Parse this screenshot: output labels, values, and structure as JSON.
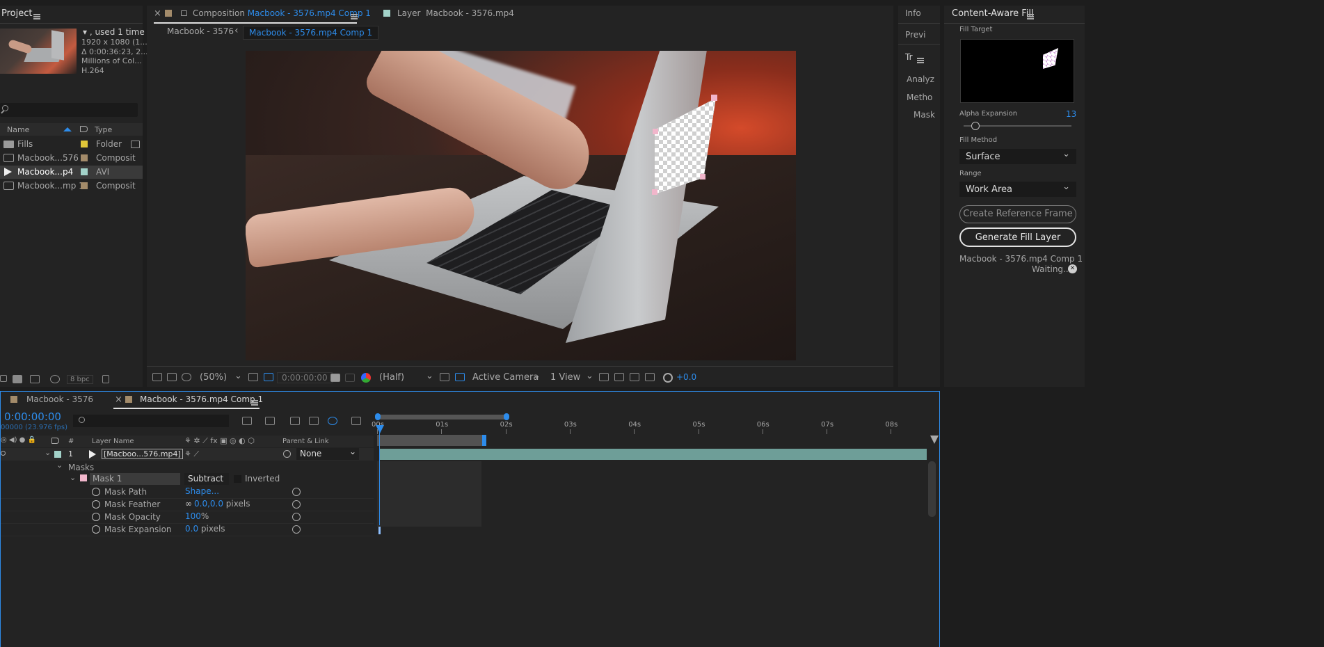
{
  "colors": {
    "accent": "#2d8ceb",
    "folder": "#e0c639",
    "comp": "#a38b6a",
    "avi": "#a3d2c9",
    "mask": "#f1b6cb",
    "bg": "#232323"
  },
  "project": {
    "title": "Project",
    "info": {
      "used": "▾ , used 1 time",
      "res": "1920 x 1080 (1...",
      "duration": "Δ 0:00:36:23, 2...",
      "colors": "Millions of Col...",
      "codec": "H.264"
    },
    "search_placeholder": "",
    "columns": {
      "name": "Name",
      "type": "Type"
    },
    "items": [
      {
        "name": "Fills",
        "type": "Folder",
        "icon": "folder-icon"
      },
      {
        "name": "Macbook...576",
        "type": "Composit",
        "icon": "composition-icon"
      },
      {
        "name": "Macbook...p4",
        "type": "AVI",
        "icon": "footage-icon"
      },
      {
        "name": "Macbook...mp 1",
        "type": "Composit",
        "icon": "composition-icon"
      }
    ],
    "bpc": "8 bpc"
  },
  "comp_viewer": {
    "tab_close": "×",
    "tab_prefix": "Composition",
    "tab_name": "Macbook - 3576.mp4 Comp 1",
    "layer_tab_prefix": "Layer",
    "layer_tab_name": "Macbook - 3576.mp4",
    "breadcrumb_1": "Macbook - 3576",
    "breadcrumb_arrow": "‹",
    "breadcrumb_2": "Macbook - 3576.mp4 Comp 1",
    "toolbar": {
      "zoom": "(50%)",
      "timecode": "0:00:00:00",
      "resolution": "(Half)",
      "camera": "Active Camera",
      "view": "1 View",
      "exposure": "+0.0"
    }
  },
  "side_tabs": {
    "info": "Info",
    "preview": "Previ",
    "tracker": "Tr",
    "analyze": "Analyz",
    "method": "Metho",
    "mask": "Mask"
  },
  "caf": {
    "title": "Content-Aware Fill",
    "fill_target_label": "Fill Target",
    "alpha_expansion_label": "Alpha Expansion",
    "alpha_expansion_value": "13",
    "alpha_expansion_level": 0.11,
    "fill_method_label": "Fill Method",
    "fill_method_value": "Surface",
    "range_label": "Range",
    "range_value": "Work Area",
    "create_ref_btn": "Create Reference Frame",
    "generate_btn": "Generate Fill Layer",
    "status_title": "Macbook - 3576.mp4 Comp 1",
    "status_text": "Waiting...",
    "cancel_glyph": "✕"
  },
  "timeline": {
    "tab1": "Macbook - 3576",
    "tab2_close": "×",
    "tab2": "Macbook - 3576.mp4 Comp 1",
    "timecode": "0:00:00:00",
    "frames": "00000 (23.976 fps)",
    "search_placeholder": "",
    "col_hash": "#",
    "col_layer_name": "Layer Name",
    "col_parent": "Parent & Link",
    "ruler": [
      "00s",
      "01s",
      "02s",
      "03s",
      "04s",
      "05s",
      "06s",
      "07s",
      "08s"
    ],
    "layer": {
      "num": "1",
      "name": "[Macboo...576.mp4]",
      "parent": "None"
    },
    "masks_group": "Masks",
    "mask1": {
      "name": "Mask 1",
      "mode": "Subtract",
      "inverted": "Inverted"
    },
    "props": [
      {
        "name": "Mask Path",
        "value": "Shape...",
        "unit": ""
      },
      {
        "name": "Mask Feather",
        "value": "0.0,0.0",
        "unit": " pixels"
      },
      {
        "name": "Mask Opacity",
        "value": "100",
        "unit": "%"
      },
      {
        "name": "Mask Expansion",
        "value": "0.0",
        "unit": " pixels"
      }
    ]
  }
}
